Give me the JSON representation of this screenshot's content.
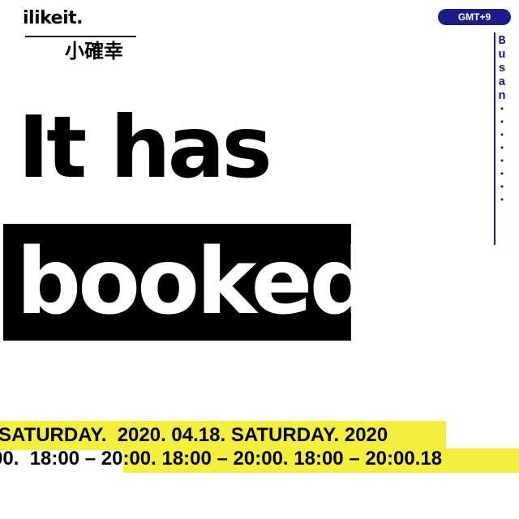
{
  "brand": {
    "name_en": "ilikeit.",
    "name_zh": "小確幸"
  },
  "badge": {
    "timezone": "GMT+9"
  },
  "city": {
    "letters": [
      "B",
      "u",
      "s",
      "a",
      "n"
    ]
  },
  "headline": {
    "line1": "It has",
    "line2": "booked!"
  },
  "ticker": {
    "date_line": "SATURDAY.  2020. 04.18. SATURDAY. 2020",
    "time_line": "00.  18:00 – 20:00. 18:00 – 20:00. 18:00 – 20:00.18"
  },
  "colors": {
    "accent_yellow": "#f4ef3c",
    "navy": "#1c1c8a",
    "black": "#000000"
  }
}
